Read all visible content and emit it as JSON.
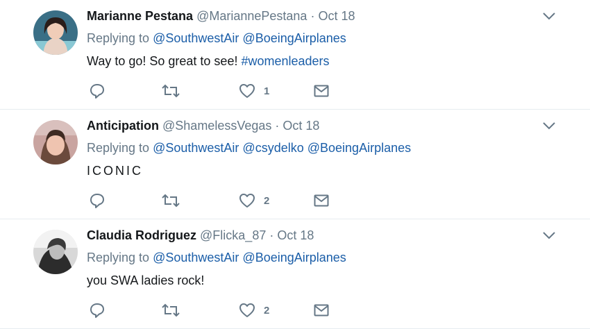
{
  "tweets": [
    {
      "name": "Marianne Pestana",
      "handle": "@MariannePestana",
      "separator": "·",
      "time": "Oct 18",
      "replying_prefix": "Replying to",
      "mentions": [
        "@SouthwestAir",
        "@BoeingAirplanes"
      ],
      "text": "Way to go!  So great to see!",
      "hashtag": "#womenleaders",
      "like_count": "1"
    },
    {
      "name": "Anticipation",
      "handle": "@ShamelessVegas",
      "separator": "·",
      "time": "Oct 18",
      "replying_prefix": "Replying to",
      "mentions": [
        "@SouthwestAir",
        "@csydelko",
        "@BoeingAirplanes"
      ],
      "text": "ICONIC",
      "hashtag": "",
      "like_count": "2"
    },
    {
      "name": "Claudia Rodriguez",
      "handle": "@Flicka_87",
      "separator": "·",
      "time": "Oct 18",
      "replying_prefix": "Replying to",
      "mentions": [
        "@SouthwestAir",
        "@BoeingAirplanes"
      ],
      "text": "you SWA ladies rock!",
      "hashtag": "",
      "like_count": "2"
    }
  ],
  "icons": {
    "reply": "reply-icon",
    "retweet": "retweet-icon",
    "like": "heart-icon",
    "dm": "envelope-icon",
    "more": "chevron-down-icon"
  },
  "colors": {
    "mention": "#1b5ea8",
    "muted": "#657786",
    "text": "#14171a",
    "divider": "#e6ecf0"
  }
}
